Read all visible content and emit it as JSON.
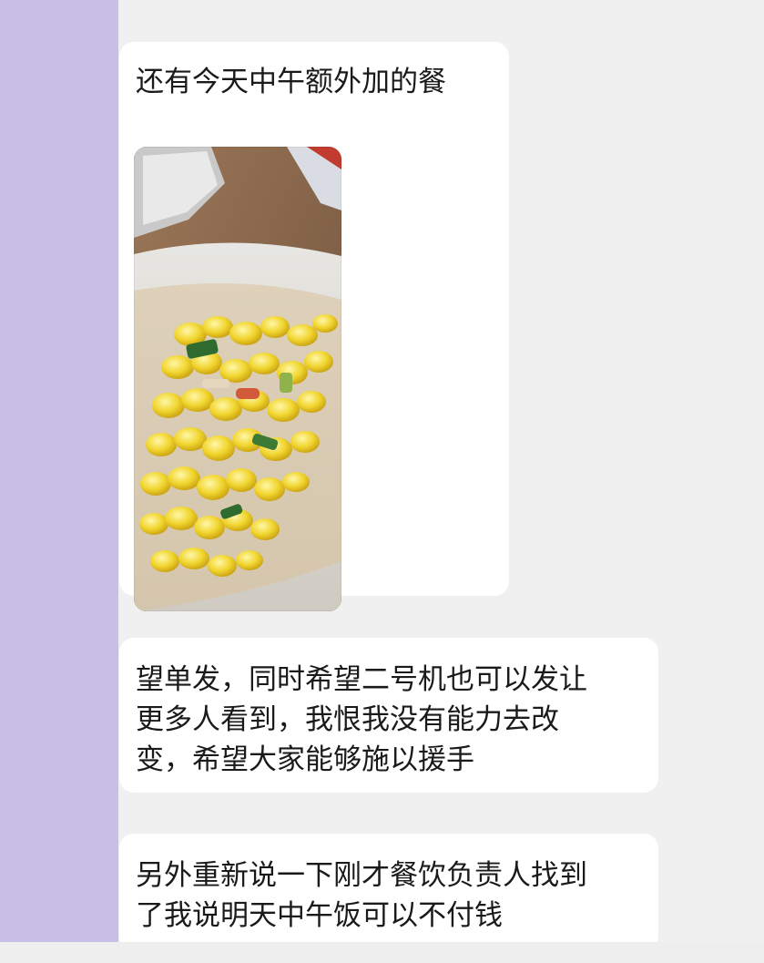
{
  "chat": {
    "messages": [
      {
        "type": "image",
        "caption": "还有今天中午额外加的餐",
        "image": {
          "subject": "corn-kernels-food-bag-photo"
        }
      },
      {
        "type": "text",
        "lines": [
          "望单发，同时希望二号机也可以发让",
          "更多人看到，我恨我没有能力去改",
          "变，希望大家能够施以援手"
        ]
      },
      {
        "type": "text",
        "lines": [
          "另外重新说一下刚才餐饮负责人找到",
          "了我说明天中午饭可以不付钱"
        ]
      }
    ]
  },
  "colors": {
    "left_panel": "#c9bfe6",
    "background": "#f0f0f0",
    "bubble": "#ffffff",
    "text": "#1a1a1a"
  }
}
